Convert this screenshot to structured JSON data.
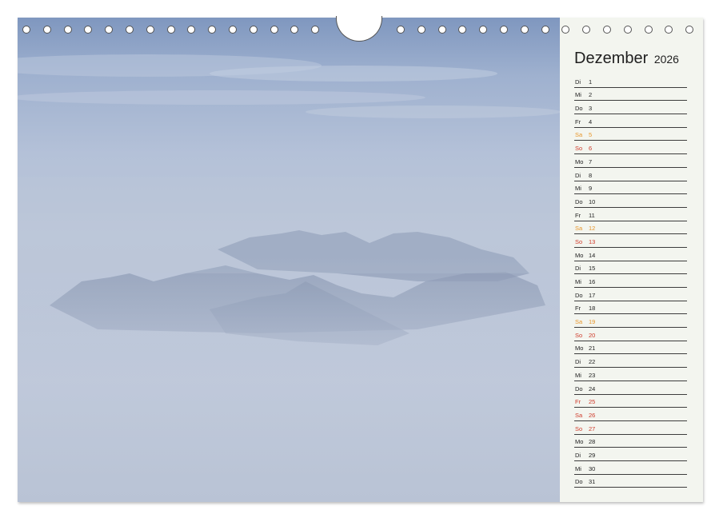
{
  "calendar": {
    "month": "Dezember",
    "year": "2026",
    "colors": {
      "saturday": "#e8962a",
      "sunday_holiday": "#cf3a2a",
      "weekday": "#222222"
    },
    "days": [
      {
        "dn": "Di",
        "num": "1",
        "type": "weekday"
      },
      {
        "dn": "Mi",
        "num": "2",
        "type": "weekday"
      },
      {
        "dn": "Do",
        "num": "3",
        "type": "weekday"
      },
      {
        "dn": "Fr",
        "num": "4",
        "type": "weekday"
      },
      {
        "dn": "Sa",
        "num": "5",
        "type": "sat"
      },
      {
        "dn": "So",
        "num": "6",
        "type": "sun"
      },
      {
        "dn": "Mo",
        "num": "7",
        "type": "weekday"
      },
      {
        "dn": "Di",
        "num": "8",
        "type": "weekday"
      },
      {
        "dn": "Mi",
        "num": "9",
        "type": "weekday"
      },
      {
        "dn": "Do",
        "num": "10",
        "type": "weekday"
      },
      {
        "dn": "Fr",
        "num": "11",
        "type": "weekday"
      },
      {
        "dn": "Sa",
        "num": "12",
        "type": "sat"
      },
      {
        "dn": "So",
        "num": "13",
        "type": "sun"
      },
      {
        "dn": "Mo",
        "num": "14",
        "type": "weekday"
      },
      {
        "dn": "Di",
        "num": "15",
        "type": "weekday"
      },
      {
        "dn": "Mi",
        "num": "16",
        "type": "weekday"
      },
      {
        "dn": "Do",
        "num": "17",
        "type": "weekday"
      },
      {
        "dn": "Fr",
        "num": "18",
        "type": "weekday"
      },
      {
        "dn": "Sa",
        "num": "19",
        "type": "sat"
      },
      {
        "dn": "So",
        "num": "20",
        "type": "sun"
      },
      {
        "dn": "Mo",
        "num": "21",
        "type": "weekday"
      },
      {
        "dn": "Di",
        "num": "22",
        "type": "weekday"
      },
      {
        "dn": "Mi",
        "num": "23",
        "type": "weekday"
      },
      {
        "dn": "Do",
        "num": "24",
        "type": "weekday"
      },
      {
        "dn": "Fr",
        "num": "25",
        "type": "sun"
      },
      {
        "dn": "Sa",
        "num": "26",
        "type": "sun"
      },
      {
        "dn": "So",
        "num": "27",
        "type": "sun"
      },
      {
        "dn": "Mo",
        "num": "28",
        "type": "weekday"
      },
      {
        "dn": "Di",
        "num": "29",
        "type": "weekday"
      },
      {
        "dn": "Mi",
        "num": "30",
        "type": "weekday"
      },
      {
        "dn": "Do",
        "num": "31",
        "type": "weekday"
      }
    ]
  },
  "photo": {
    "subject": "misty-mountain-ridges-above-clouds"
  },
  "binding": {
    "ring_icon": "binding-ring-icon",
    "hanger_icon": "hanger-notch-icon"
  }
}
